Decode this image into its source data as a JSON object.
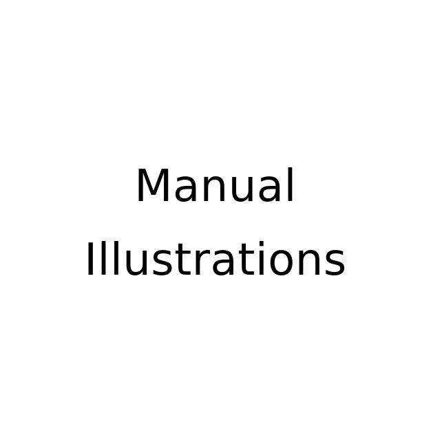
{
  "title": {
    "lines": [
      "Manual",
      "Illustrations"
    ]
  },
  "colors": {
    "background": "#ffffff",
    "text": "#000000"
  }
}
